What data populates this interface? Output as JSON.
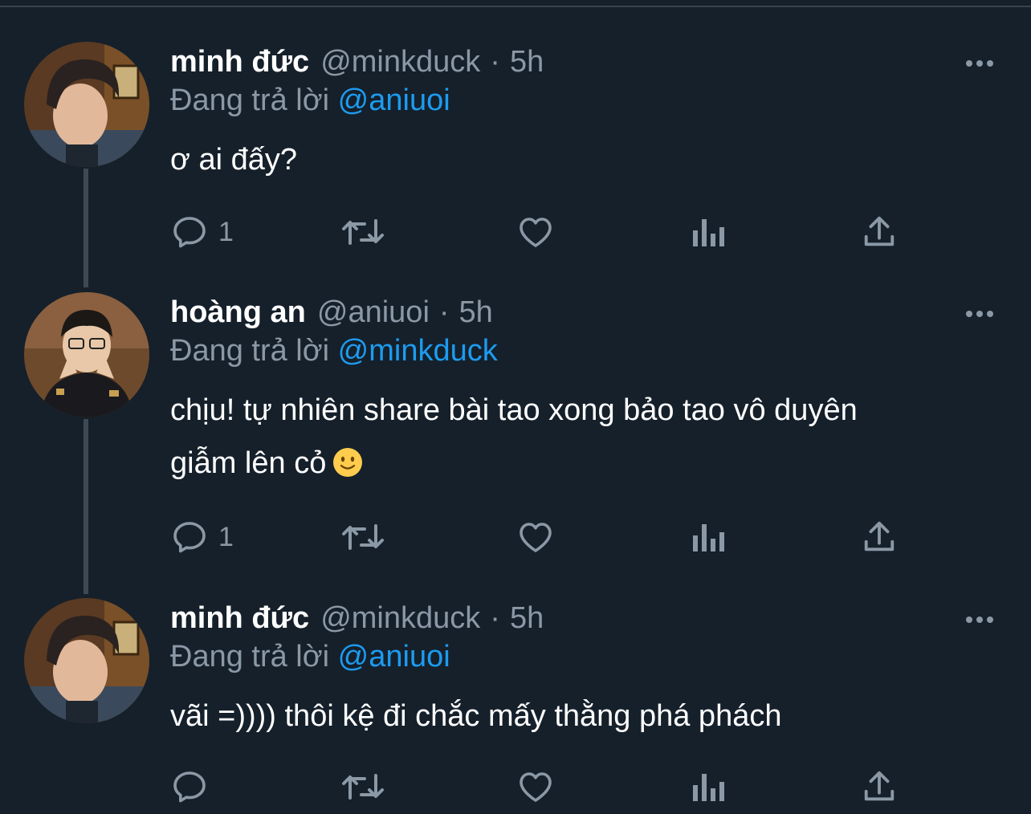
{
  "colors": {
    "background": "#15202b",
    "secondary_text": "#8b98a5",
    "mention": "#1d9bf0",
    "thread_line": "#3d4a55"
  },
  "reply_prefix": "Đang trả lời",
  "tweets": [
    {
      "author_name": "minh đức",
      "handle": "@minkduck",
      "separator": "·",
      "time": "5h",
      "replying_to": "@aniuoi",
      "text_lines": [
        "ơ ai đấy?"
      ],
      "emoji": "",
      "reply_count": "1",
      "avatar": "minkduck-avatar"
    },
    {
      "author_name": "hoàng an",
      "handle": "@aniuoi",
      "separator": "·",
      "time": "5h",
      "replying_to": "@minkduck",
      "text_lines": [
        "chịu! tự nhiên share bài tao xong bảo tao vô duyên",
        "giẫm lên cỏ"
      ],
      "emoji": "slightly-smiling-face",
      "reply_count": "1",
      "avatar": "aniuoi-avatar"
    },
    {
      "author_name": "minh đức",
      "handle": "@minkduck",
      "separator": "·",
      "time": "5h",
      "replying_to": "@aniuoi",
      "text_lines": [
        "vãi =)))) thôi kệ đi chắc mấy thằng phá phách"
      ],
      "emoji": "",
      "reply_count": "",
      "avatar": "minkduck-avatar"
    }
  ],
  "icons": {
    "reply": "reply-icon",
    "retweet": "retweet-icon",
    "like": "heart-icon",
    "analytics": "analytics-icon",
    "share": "share-icon",
    "more": "more-icon"
  }
}
